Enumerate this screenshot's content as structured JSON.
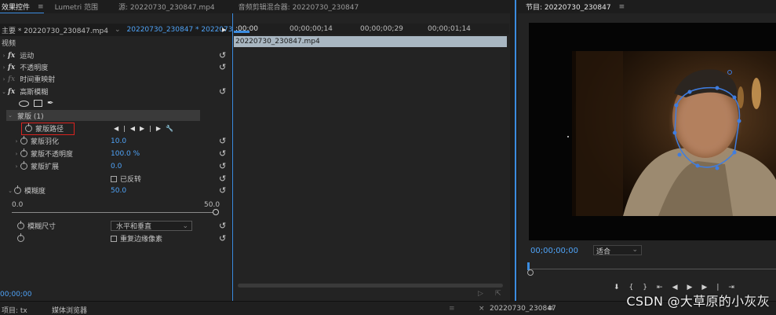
{
  "top_tabs": {
    "effect_controls": "效果控件",
    "menu": "≡",
    "lumetri": "Lumetri 范围",
    "source": "源: 20220730_230847.mp4",
    "audio_mixer": "音频剪辑混合器: 20220730_230847"
  },
  "program_tab": {
    "label": "节目: 20220730_230847",
    "menu": "≡"
  },
  "clip_bar": {
    "master": "主要 * 20220730_230847.mp4",
    "sequence": "20220730_230847 * 20220730_2..."
  },
  "ruler": {
    "t0": ":00;00",
    "t1": "00;00;00;14",
    "t2": "00;00;00;29",
    "t3": "00;00;01;14"
  },
  "clip_name": "20220730_230847.mp4",
  "effects": {
    "video_header": "视频",
    "motion": "运动",
    "opacity": "不透明度",
    "time_remap": "时间重映射",
    "gaussian": "高斯模糊",
    "mask_header": "蒙版 (1)",
    "mask_path": "蒙版路径",
    "mask_feather": "蒙版羽化",
    "mask_feather_val": "10.0",
    "mask_opacity": "蒙版不透明度",
    "mask_opacity_val": "100.0 %",
    "mask_expand": "蒙版扩展",
    "mask_expand_val": "0.0",
    "inverted": "已反转",
    "blurriness": "模糊度",
    "blurriness_val": "50.0",
    "slider_min": "0.0",
    "slider_max": "50.0",
    "blur_dim": "模糊尺寸",
    "blur_dim_val": "水平和垂直",
    "repeat_edge": "重复边缘像素",
    "fx": "fx"
  },
  "footer_time": "00;00;00",
  "program": {
    "timecode": "00;00;00;00",
    "fit": "适合"
  },
  "bottom": {
    "project": "项目: tx",
    "media_browser": "媒体浏览器",
    "seq_tab": "20220730_230847",
    "menu": "≡"
  },
  "watermark": "CSDN @大草原的小灰灰",
  "colors": {
    "accent": "#3b8ce0",
    "value": "#4fa3f7",
    "highlight": "#d9231f"
  }
}
